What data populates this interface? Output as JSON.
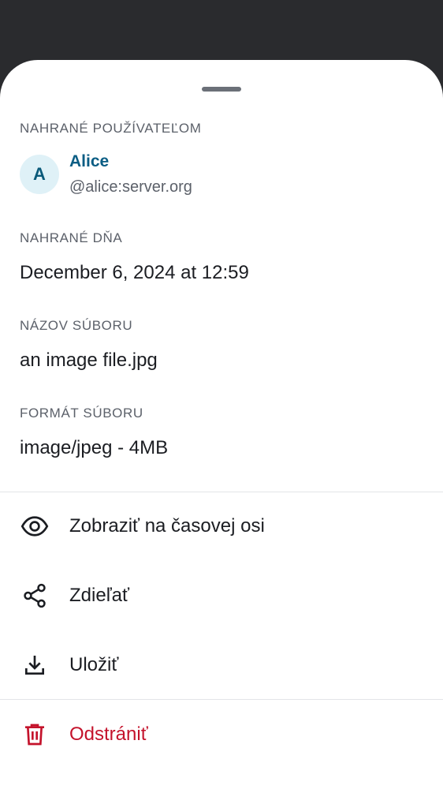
{
  "sheet": {
    "uploader": {
      "section_label": "NAHRANÉ POUŽÍVATEĽOM",
      "avatar_letter": "A",
      "name": "Alice",
      "user_id": "@alice:server.org"
    },
    "uploaded_on": {
      "section_label": "NAHRANÉ DŇA",
      "value": "December 6, 2024 at 12:59"
    },
    "file_name": {
      "section_label": "NÁZOV SÚBORU",
      "value": "an image file.jpg"
    },
    "file_format": {
      "section_label": "FORMÁT SÚBORU",
      "value": "image/jpeg - 4MB"
    },
    "actions": {
      "view_in_timeline": {
        "label": "Zobraziť na časovej osi",
        "icon": "eye-icon"
      },
      "share": {
        "label": "Zdieľať",
        "icon": "share-icon"
      },
      "save": {
        "label": "Uložiť",
        "icon": "download-icon"
      },
      "delete": {
        "label": "Odstrániť",
        "icon": "trash-icon"
      }
    }
  },
  "colors": {
    "accent_name": "#0b5d84",
    "danger": "#c4122b",
    "avatar_bg": "#dff1f7",
    "scrim": "#2a2b2e"
  }
}
